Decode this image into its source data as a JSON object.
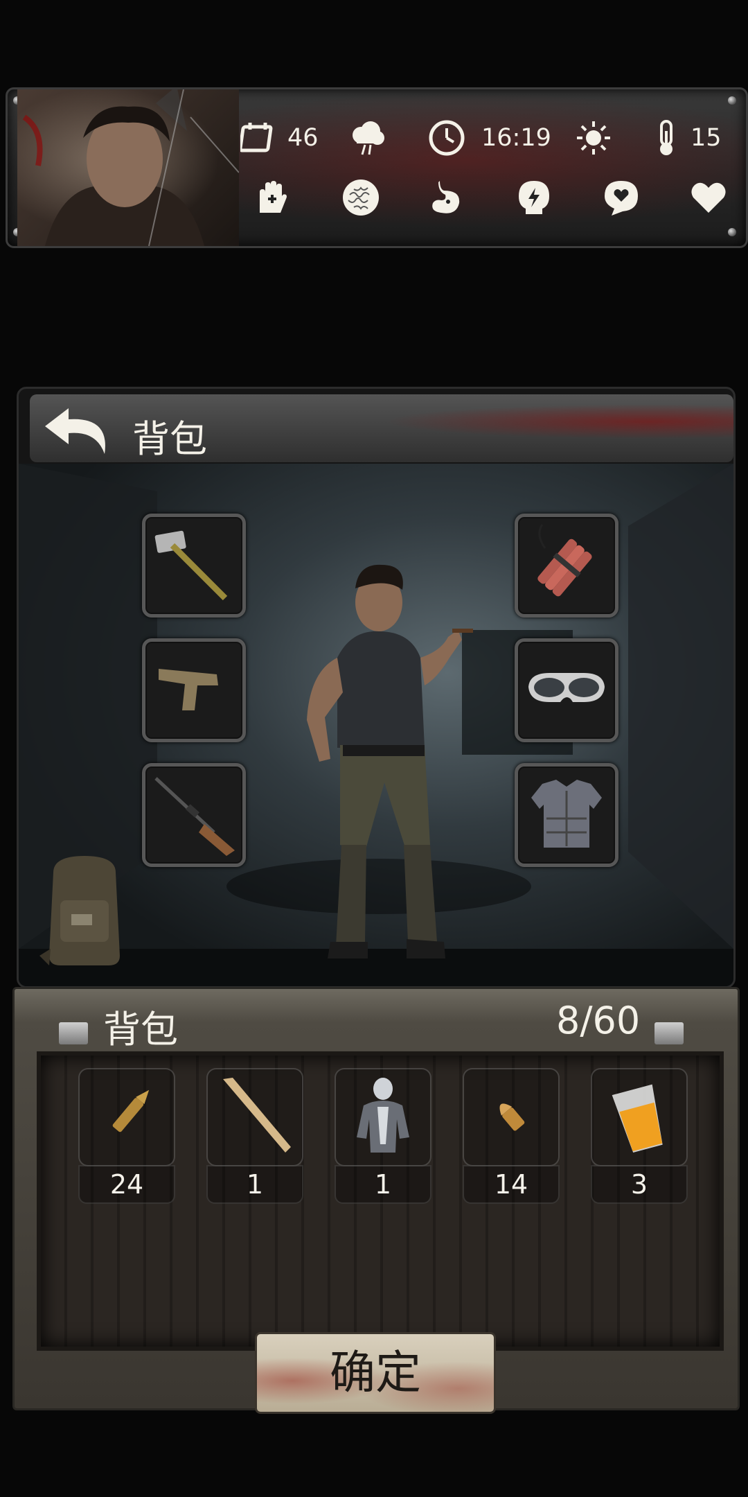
{
  "status_bar": {
    "day_count": "46",
    "time": "16:19",
    "temperature": "15",
    "icons_row1": [
      "calendar-icon",
      "storm-cloud-icon",
      "clock-icon",
      "sun-icon",
      "thermometer-icon"
    ],
    "icons_row2": [
      "hand-medical-icon",
      "brain-icon",
      "stomach-icon",
      "energy-icon",
      "mood-icon",
      "heart-icon"
    ]
  },
  "equipment_panel": {
    "title": "背包",
    "left_slots": [
      "sledgehammer",
      "pistol",
      "rifle"
    ],
    "right_slots": [
      "dynamite",
      "goggles",
      "body-armor"
    ]
  },
  "inventory": {
    "title": "背包",
    "capacity": "8/60",
    "items": [
      {
        "name": "rifle-bullet",
        "qty": "24"
      },
      {
        "name": "baseball-bat",
        "qty": "1"
      },
      {
        "name": "nanosuit-armor",
        "qty": "1"
      },
      {
        "name": "pistol-bullet",
        "qty": "14"
      },
      {
        "name": "juice-glass",
        "qty": "3"
      }
    ]
  },
  "confirm_label": "确定",
  "colors": {
    "accent_text": "#f4f1e8",
    "blood": "#8c0a0a",
    "wood": "#2b2622"
  }
}
